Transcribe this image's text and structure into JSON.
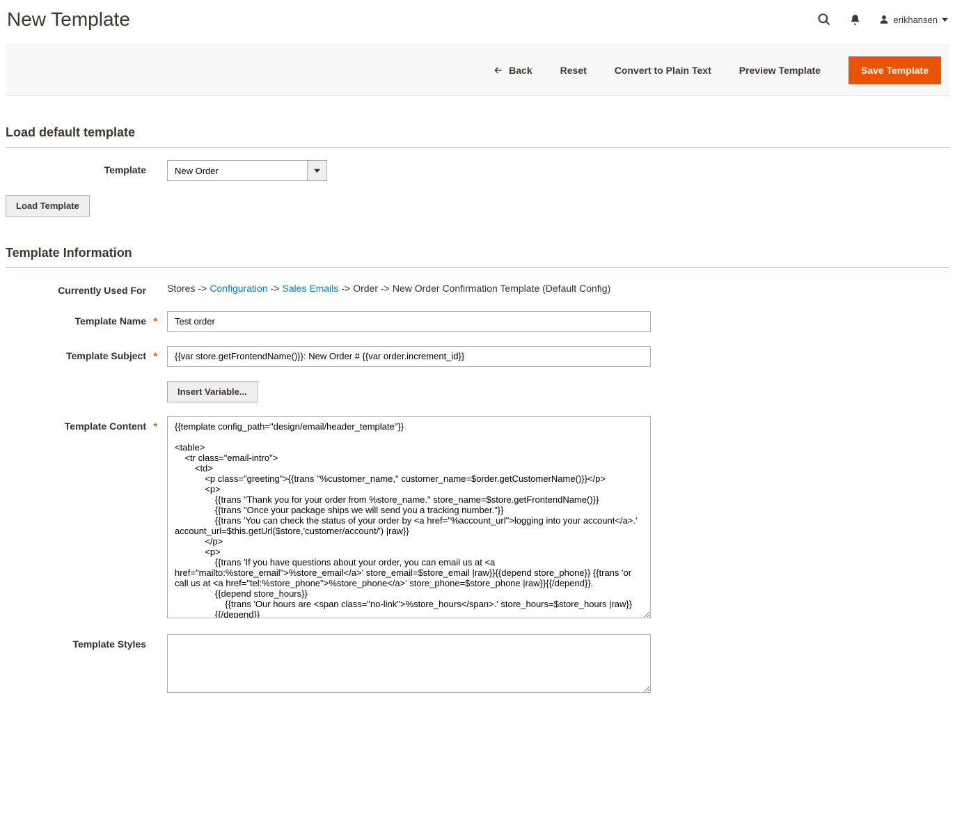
{
  "header": {
    "title": "New Template",
    "username": "erikhansen"
  },
  "actionBar": {
    "back": "Back",
    "reset": "Reset",
    "convert": "Convert to Plain Text",
    "preview": "Preview Template",
    "save": "Save Template"
  },
  "loadSection": {
    "title": "Load default template",
    "templateLabel": "Template",
    "templateSelected": "New Order",
    "loadButton": "Load Template"
  },
  "infoSection": {
    "title": "Template Information",
    "usedForLabel": "Currently Used For",
    "path": {
      "p1": "Stores",
      "p2": "Configuration",
      "p3": "Sales Emails",
      "p4": "Order",
      "p5": "New Order Confirmation Template  (Default Config)"
    },
    "nameLabel": "Template Name",
    "nameValue": "Test order",
    "subjectLabel": "Template Subject",
    "subjectValue": "{{var store.getFrontendName()}}: New Order # {{var order.increment_id}}",
    "insertVariable": "Insert Variable...",
    "contentLabel": "Template Content",
    "contentValue": "{{template config_path=\"design/email/header_template\"}}\n\n<table>\n    <tr class=\"email-intro\">\n        <td>\n            <p class=\"greeting\">{{trans \"%customer_name,\" customer_name=$order.getCustomerName()}}</p>\n            <p>\n                {{trans \"Thank you for your order from %store_name.\" store_name=$store.getFrontendName()}}\n                {{trans \"Once your package ships we will send you a tracking number.\"}}\n                {{trans 'You can check the status of your order by <a href=\"%account_url\">logging into your account</a>.' account_url=$this.getUrl($store,'customer/account/') |raw}}\n            </p>\n            <p>\n                {{trans 'If you have questions about your order, you can email us at <a href=\"mailto:%store_email\">%store_email</a>' store_email=$store_email |raw}}{{depend store_phone}} {{trans 'or call us at <a href=\"tel:%store_phone\">%store_phone</a>' store_phone=$store_phone |raw}}{{/depend}}.\n                {{depend store_hours}}\n                    {{trans 'Our hours are <span class=\"no-link\">%store_hours</span>.' store_hours=$store_hours |raw}}\n                {{/depend}}\n            </p>\n        </td>",
    "stylesLabel": "Template Styles",
    "stylesValue": ""
  }
}
